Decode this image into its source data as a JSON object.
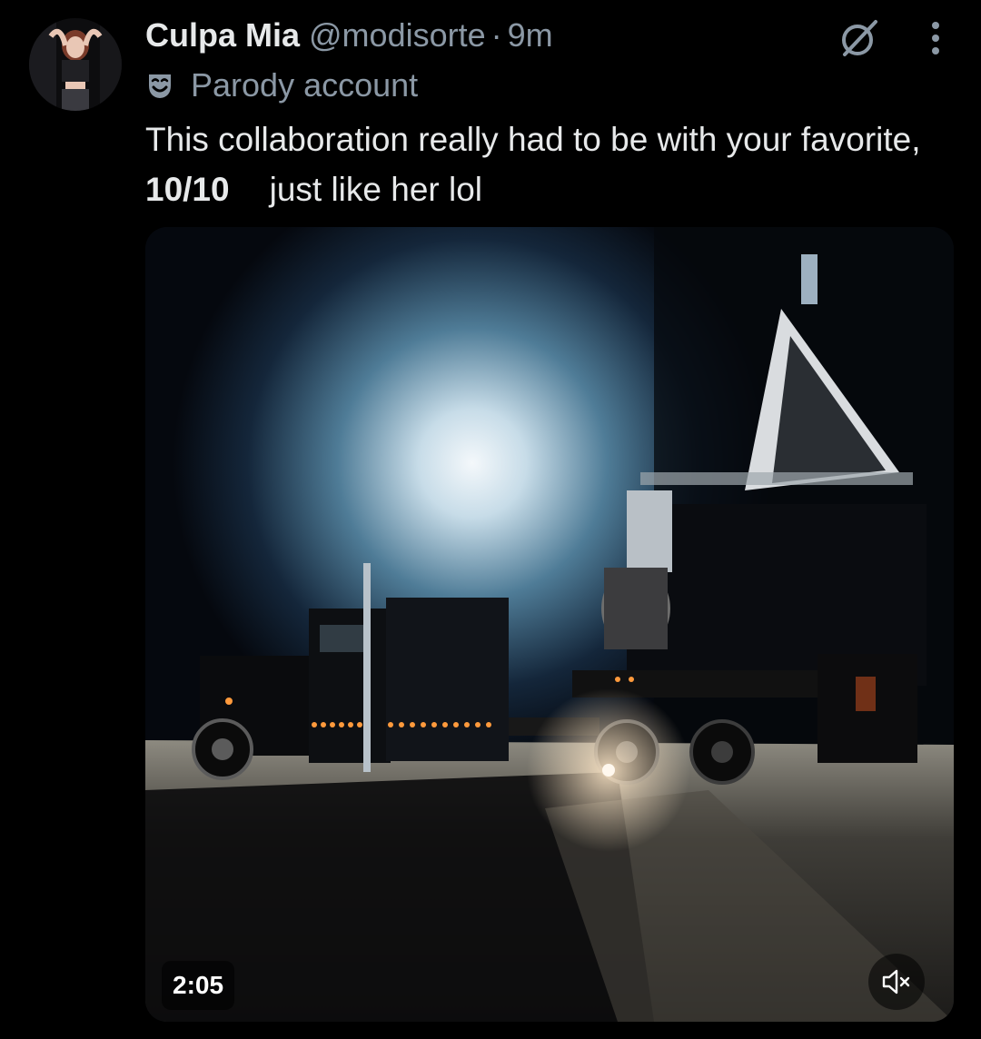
{
  "author": {
    "display_name": "Culpa Mia",
    "handle": "@modisorte",
    "separator": "·",
    "time": "9m",
    "account_label": "Parody account"
  },
  "post": {
    "text_before": "This collaboration really had to be with your favorite, ",
    "text_bold": "10/10",
    "text_after": "just like her lol"
  },
  "video": {
    "duration": "2:05",
    "muted": true
  },
  "icons": {
    "grok": "grok-icon",
    "more": "more-options-icon",
    "parody": "parody-mask-icon",
    "mute": "speaker-muted-icon"
  }
}
